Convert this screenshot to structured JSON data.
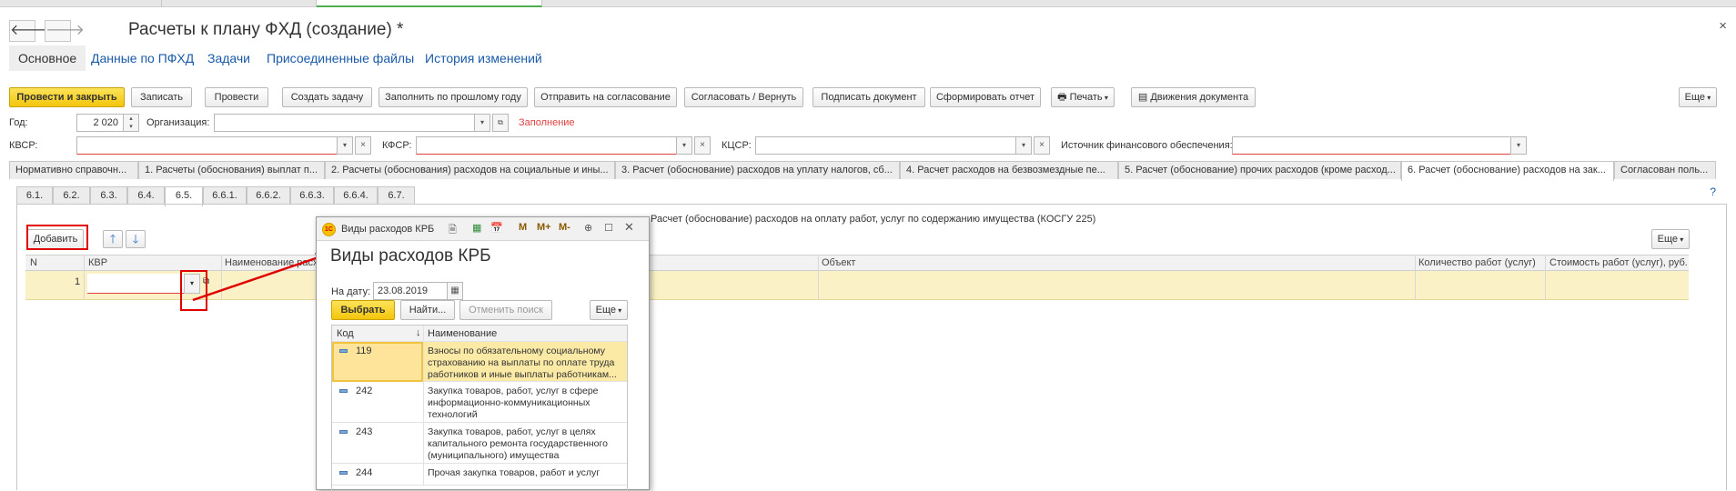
{
  "window": {
    "title": "Расчеты к плану ФХД (создание) *",
    "close_glyph": "×",
    "back_glyph": "🡐",
    "forward_glyph": "🡒"
  },
  "main_nav": [
    "Основное",
    "Данные по ПФХД",
    "Задачи",
    "Присоединенные файлы",
    "История изменений"
  ],
  "toolbar": {
    "buttons": [
      "Провести и закрыть",
      "Записать",
      "Провести",
      "Создать задачу",
      "Заполнить по прошлому году",
      "Отправить на согласование",
      "Согласовать / Вернуть",
      "Подписать документ",
      "Сформировать отчет",
      "Печать",
      "Движения документа",
      "Еще"
    ]
  },
  "form": {
    "year_label": "Год:",
    "year_value": "2 020",
    "org_label": "Организация:",
    "org_value": "",
    "fill_status": "Заполнение",
    "kvsr_label": "КВСР:",
    "kfsr_label": "КФСР:",
    "kcsr_label": "КЦСР:",
    "source_label": "Источник финансового обеспечения:"
  },
  "tabs": [
    "Нормативно справочн...",
    "1. Расчеты (обоснования) выплат п...",
    "2. Расчеты (обоснования) расходов на социальные и ины...",
    "3. Расчет (обоснование) расходов на уплату налогов, сб...",
    "4. Расчет расходов на безвозмездные пе...",
    "5. Расчет (обоснование) прочих расходов (кроме расход...",
    "6. Расчет (обоснование) расходов на зак...",
    "Согласован поль..."
  ],
  "subtabs": [
    "6.1.",
    "6.2.",
    "6.3.",
    "6.4.",
    "6.5.",
    "6.6.1.",
    "6.6.2.",
    "6.6.3.",
    "6.6.4.",
    "6.7."
  ],
  "section_caption": "Расчет (обоснование) расходов на оплату работ, услуг по содержанию имущества (КОСГУ 225)",
  "table": {
    "add_button": "Добавить",
    "more_button": "Еще",
    "columns": [
      "N",
      "КВР",
      "Наименование расх",
      "Объект",
      "Количество работ (услуг)",
      "Стоимость работ (услуг), руб."
    ],
    "rows": [
      {
        "n": "1",
        "kvr": ""
      }
    ]
  },
  "help_glyph": "?",
  "popup": {
    "window_title": "Виды расходов КРБ",
    "heading": "Виды расходов КРБ",
    "date_label": "На дату:",
    "date_value": "23.08.2019",
    "select_button": "Выбрать",
    "find_button": "Найти...",
    "cancel_search_button": "Отменить поиск",
    "more_button": "Еще",
    "col_code": "Код",
    "col_name": "Наименование",
    "sort_glyph": "↓",
    "toolbar_glyphs": [
      "M",
      "M+",
      "M-"
    ],
    "rows": [
      {
        "code": "119",
        "name": "Взносы по обязательному социальному страхованию на выплаты по оплате труда работников и иные выплаты работникам..."
      },
      {
        "code": "242",
        "name": "Закупка товаров, работ, услуг в сфере информационно-коммуникационных технологий"
      },
      {
        "code": "243",
        "name": "Закупка товаров, работ, услуг в целях капитального ремонта государственного (муниципального) имущества"
      },
      {
        "code": "244",
        "name": "Прочая закупка товаров, работ и услуг"
      }
    ]
  },
  "colors": {
    "accent_yellow": "#f3c60c",
    "link_blue": "#1a5aa8",
    "error_red": "#e04040",
    "annotation_red": "#e00000"
  }
}
